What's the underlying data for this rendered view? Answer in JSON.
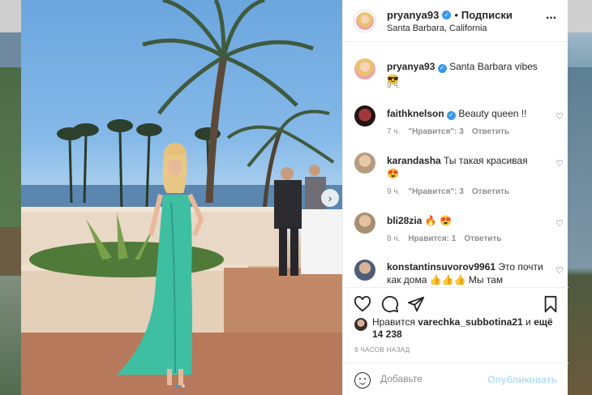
{
  "post": {
    "username": "pryanya93",
    "follow_label": "Подписки",
    "separator": "•",
    "location": "Santa Barbara, California",
    "more_icon": "more-horizontal-icon",
    "photo_dots": 2,
    "photo_active_dot": 1
  },
  "comments": [
    {
      "username": "pryanya93",
      "verified": true,
      "text": "Santa Barbara vibes",
      "emoji": "😎",
      "time": "9 ч.",
      "likes": "",
      "reply": ""
    },
    {
      "username": "faithknelson",
      "verified": true,
      "text": "Beauty queen !!",
      "emoji": "",
      "time": "7 ч.",
      "likes": "\"Нравится\": 3",
      "reply": "Ответить"
    },
    {
      "username": "karandasha",
      "verified": false,
      "text": "Ты такая красивая",
      "emoji": "😍",
      "time": "9 ч.",
      "likes": "\"Нравится\": 3",
      "reply": "Ответить"
    },
    {
      "username": "bli28zia",
      "verified": false,
      "text": "",
      "emoji": "🔥 😍",
      "time": "8 ч.",
      "likes": "Нравится: 1",
      "reply": "Ответить"
    },
    {
      "username": "konstantinsuvorov9961",
      "verified": false,
      "text": "Это почти как дома 👍👍👍 Мы там",
      "emoji": "",
      "time": "",
      "likes": "",
      "reply": ""
    }
  ],
  "actions": {
    "like_icon": "heart-icon",
    "comment_icon": "comment-icon",
    "share_icon": "share-icon",
    "save_icon": "bookmark-icon"
  },
  "likes": {
    "prefix": "Нравится",
    "user": "varechka_subbotina21",
    "conj": "и",
    "count": "ещё 14 238"
  },
  "time_ago": "9 ЧАСОВ НАЗАД",
  "add_comment": {
    "placeholder": "Добавьте",
    "post_label": "Опубликовать"
  },
  "colors": {
    "verified": "#3897f0",
    "link_disabled": "#b2dffc",
    "muted": "#8e8e8e"
  }
}
